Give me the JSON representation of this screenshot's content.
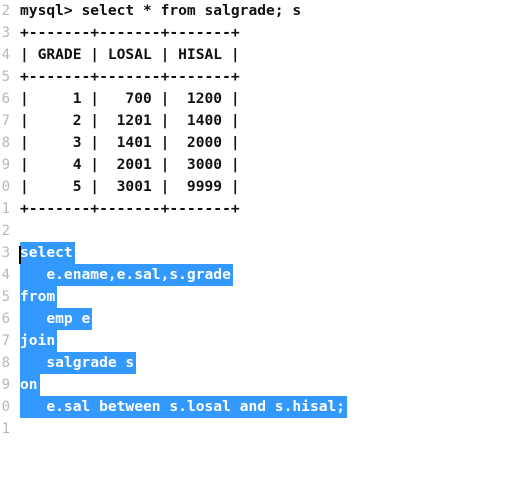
{
  "editor": {
    "line_numbers": [
      "2",
      "3",
      "4",
      "5",
      "6",
      "7",
      "8",
      "9",
      "0",
      "1",
      "2",
      "3",
      "4",
      "5",
      "6",
      "7",
      "8",
      "9",
      "0",
      "1"
    ],
    "lines": [
      "mysql> select * from salgrade; s",
      "+-------+-------+-------+",
      "| GRADE | LOSAL | HISAL |",
      "+-------+-------+-------+",
      "|     1 |   700 |  1200 |",
      "|     2 |  1201 |  1400 |",
      "|     3 |  1401 |  2000 |",
      "|     4 |  2001 |  3000 |",
      "|     5 |  3001 |  9999 |",
      "+-------+-------+-------+",
      "",
      "select",
      "   e.ename,e.sal,s.grade",
      "from",
      "   emp e",
      "join",
      "   salgrade s",
      "on",
      "   e.sal between s.losal and s.hisal;",
      ""
    ],
    "selection_color": "#3399ff"
  }
}
